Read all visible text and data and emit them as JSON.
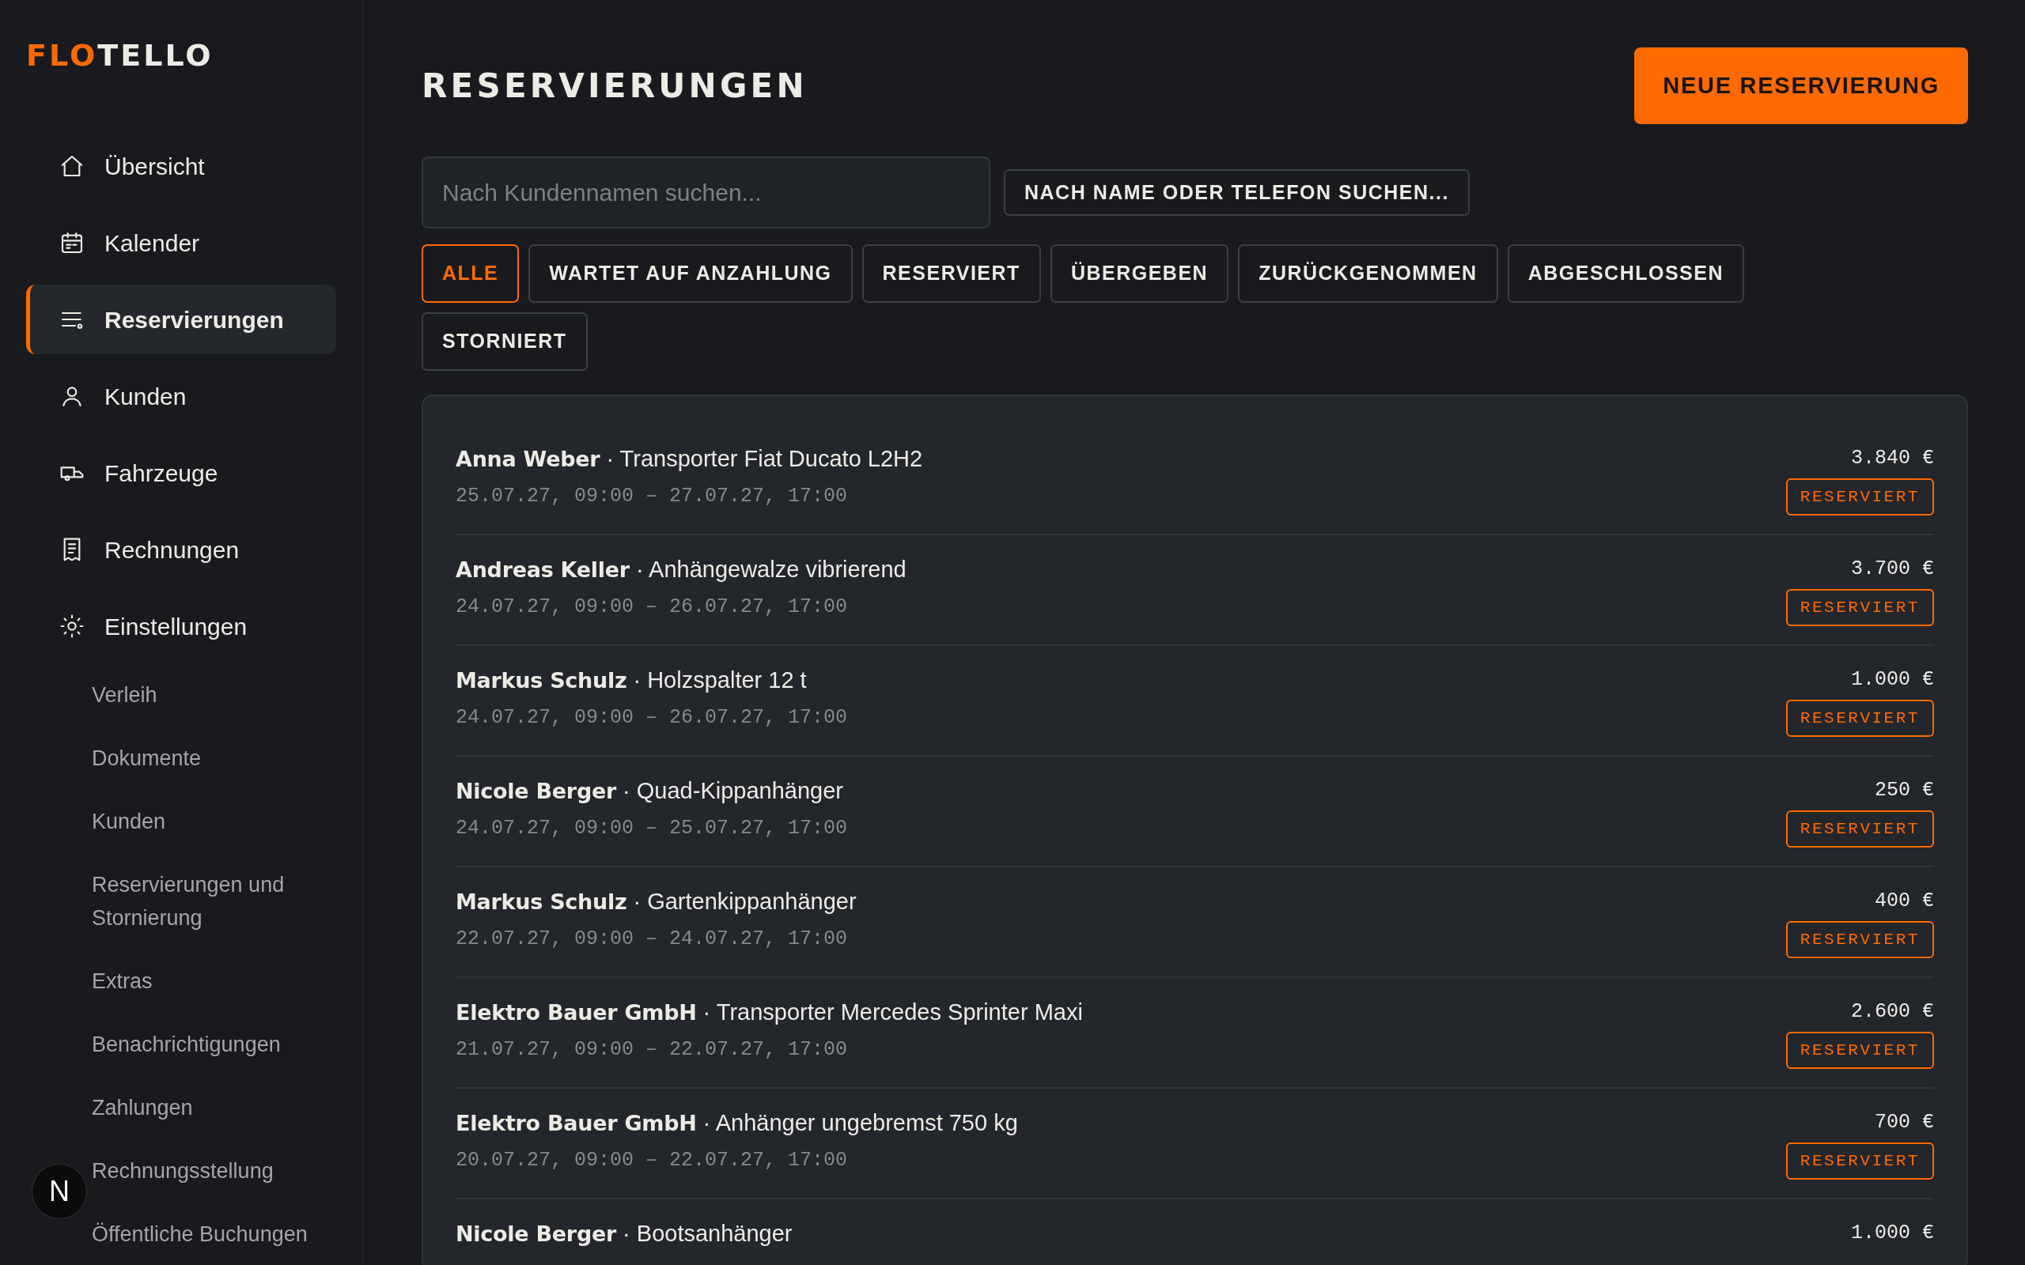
{
  "logo": {
    "accent": "FLO",
    "rest": "TELLO"
  },
  "sidebar": {
    "items": [
      {
        "label": "Übersicht",
        "selected": false
      },
      {
        "label": "Kalender",
        "selected": false
      },
      {
        "label": "Reservierungen",
        "selected": true
      },
      {
        "label": "Kunden",
        "selected": false
      },
      {
        "label": "Fahrzeuge",
        "selected": false
      },
      {
        "label": "Rechnungen",
        "selected": false
      },
      {
        "label": "Einstellungen",
        "selected": false,
        "children": [
          {
            "label": "Verleih"
          },
          {
            "label": "Dokumente"
          },
          {
            "label": "Kunden"
          },
          {
            "label": "Reservierungen und Stornierung"
          },
          {
            "label": "Extras"
          },
          {
            "label": "Benachrichtigungen"
          },
          {
            "label": "Zahlungen"
          },
          {
            "label": "Rechnungsstellung"
          },
          {
            "label": "Öffentliche Buchungen"
          }
        ]
      }
    ]
  },
  "dev_badge": "N",
  "page_title": "RESERVIERUNGEN",
  "new_button": "NEUE RESERVIERUNG",
  "search": {
    "placeholder": "Nach Kundennamen suchen...",
    "button": "NACH NAME ODER TELEFON SUCHEN..."
  },
  "filters": [
    {
      "label": "ALLE",
      "selected": true
    },
    {
      "label": "WARTET AUF ANZAHLUNG",
      "selected": false
    },
    {
      "label": "RESERVIERT",
      "selected": false
    },
    {
      "label": "ÜBERGEBEN",
      "selected": false
    },
    {
      "label": "ZURÜCKGENOMMEN",
      "selected": false
    },
    {
      "label": "ABGESCHLOSSEN",
      "selected": false
    },
    {
      "label": "STORNIERT",
      "selected": false
    }
  ],
  "reservations": [
    {
      "title": "**Anna Weber** · Transporter Fiat Ducato L2H2",
      "dates": "25.07.27, 09:00 – 27.07.27, 17:00",
      "price": "3.840 €",
      "status": "RESERVIERT"
    },
    {
      "title": "**Andreas Keller** · Anhängewalze vibrierend",
      "dates": "24.07.27, 09:00 – 26.07.27, 17:00",
      "price": "3.700 €",
      "status": "RESERVIERT"
    },
    {
      "title": "**Markus Schulz** · Holzspalter 12 t",
      "dates": "24.07.27, 09:00 – 26.07.27, 17:00",
      "price": "1.000 €",
      "status": "RESERVIERT"
    },
    {
      "title": "**Nicole Berger** · Quad-Kippanhänger",
      "dates": "24.07.27, 09:00 – 25.07.27, 17:00",
      "price": "250 €",
      "status": "RESERVIERT"
    },
    {
      "title": "**Markus Schulz** · Gartenkippanhänger",
      "dates": "22.07.27, 09:00 – 24.07.27, 17:00",
      "price": "400 €",
      "status": "RESERVIERT"
    },
    {
      "title": "**Elektro Bauer GmbH** · Transporter Mercedes Sprinter Maxi",
      "dates": "21.07.27, 09:00 – 22.07.27, 17:00",
      "price": "2.600 €",
      "status": "RESERVIERT"
    },
    {
      "title": "**Elektro Bauer GmbH** · Anhänger ungebremst 750 kg",
      "dates": "20.07.27, 09:00 – 22.07.27, 17:00",
      "price": "700 €",
      "status": "RESERVIERT"
    },
    {
      "title": "**Nicole Berger** · Bootsanhänger",
      "price": "1.000 €"
    }
  ]
}
